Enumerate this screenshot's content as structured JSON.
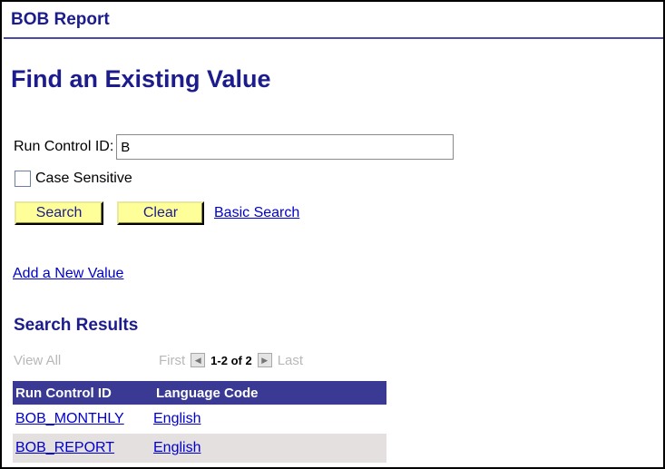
{
  "header": {
    "title": "BOB Report"
  },
  "page": {
    "title": "Find an Existing Value"
  },
  "search_form": {
    "run_control_label": "Run Control ID:",
    "run_control_value": "B",
    "case_sensitive_label": "Case Sensitive",
    "case_sensitive_checked": false,
    "search_button": "Search",
    "clear_button": "Clear",
    "basic_search_link": "Basic Search",
    "add_new_value_link": "Add a New Value"
  },
  "results": {
    "title": "Search Results",
    "view_all": "View All",
    "first": "First",
    "count": "1-2 of 2",
    "last": "Last",
    "columns": [
      "Run Control ID",
      "Language Code"
    ],
    "rows": [
      {
        "run_control_id": "BOB_MONTHLY",
        "language": "English"
      },
      {
        "run_control_id": "BOB_REPORT",
        "language": "English"
      }
    ]
  },
  "colors": {
    "title": "#1c1c8c",
    "table_header": "#3a3a94",
    "button_bg": "#ffff99",
    "link": "#0000cc",
    "alt_row": "#e5e0e0"
  }
}
